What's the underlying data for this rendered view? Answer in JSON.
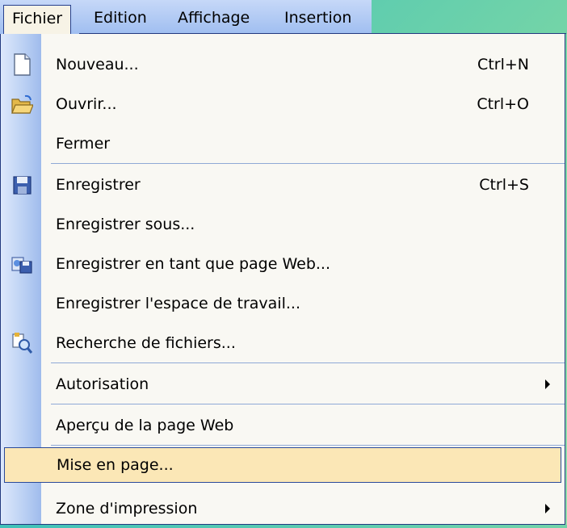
{
  "menubar": {
    "items": [
      {
        "label": "Fichier",
        "active": true
      },
      {
        "label": "Edition"
      },
      {
        "label": "Affichage"
      },
      {
        "label": "Insertion"
      }
    ]
  },
  "file_menu": {
    "items": [
      {
        "label": "Nouveau...",
        "shortcut": "Ctrl+N",
        "icon": "new-document-icon"
      },
      {
        "label": "Ouvrir...",
        "shortcut": "Ctrl+O",
        "icon": "open-folder-icon"
      },
      {
        "label": "Fermer"
      },
      {
        "label": "Enregistrer",
        "shortcut": "Ctrl+S",
        "icon": "save-disk-icon"
      },
      {
        "label": "Enregistrer sous..."
      },
      {
        "label": "Enregistrer en tant que page Web...",
        "icon": "save-web-page-icon"
      },
      {
        "label": "Enregistrer l'espace de travail..."
      },
      {
        "label": "Recherche de fichiers...",
        "icon": "file-search-icon"
      },
      {
        "label": "Autorisation",
        "submenu": true
      },
      {
        "label": "Aperçu de la page Web"
      },
      {
        "label": "Mise en page...",
        "highlighted": true
      },
      {
        "label": "Zone d'impression",
        "submenu": true
      }
    ]
  },
  "colors": {
    "menubar": "#9ebdf0",
    "menu_bg": "#f9f8f3",
    "gutter": "#b9cff3",
    "highlight": "#fbe7b6",
    "border": "#23397f"
  }
}
